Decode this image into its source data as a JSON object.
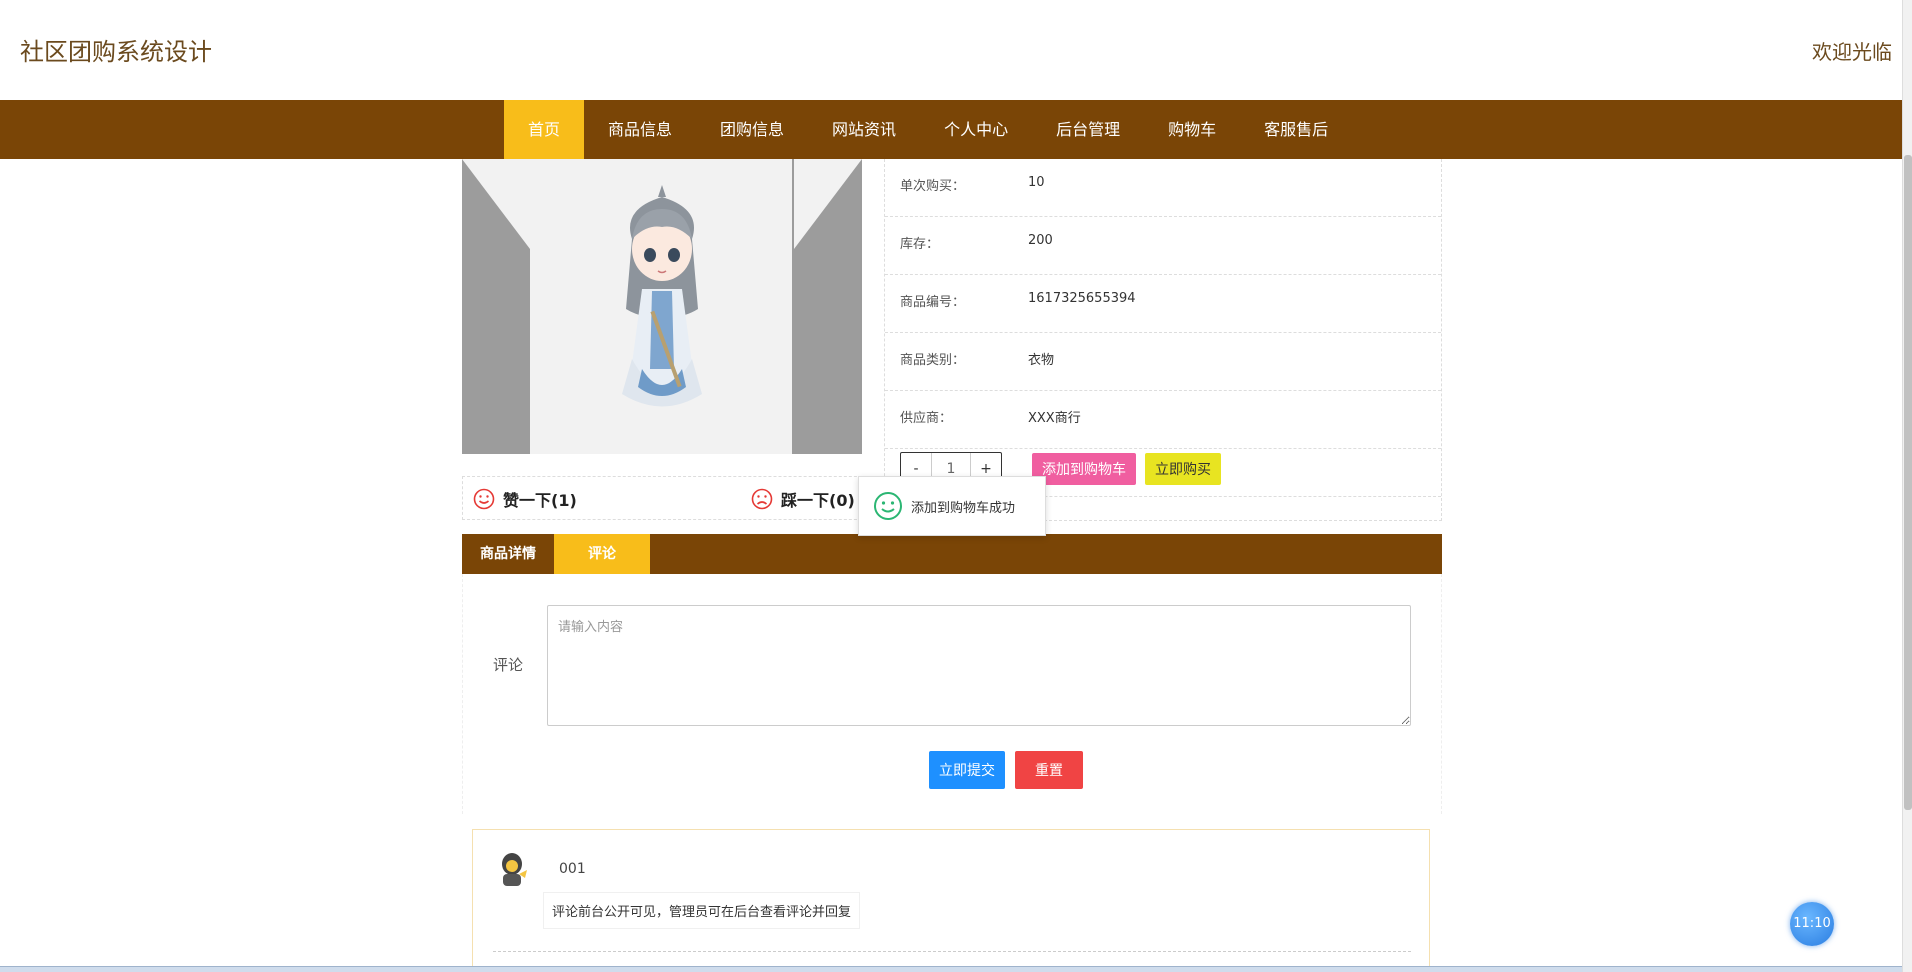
{
  "header": {
    "site_title": "社区团购系统设计",
    "welcome": "欢迎光临"
  },
  "nav": {
    "items": [
      {
        "label": "首页",
        "active": true
      },
      {
        "label": "商品信息",
        "active": false
      },
      {
        "label": "团购信息",
        "active": false
      },
      {
        "label": "网站资讯",
        "active": false
      },
      {
        "label": "个人中心",
        "active": false
      },
      {
        "label": "后台管理",
        "active": false
      },
      {
        "label": "购物车",
        "active": false
      },
      {
        "label": "客服售后",
        "active": false
      }
    ],
    "colors": {
      "bar": "#7a4506",
      "active": "#f8bd1a"
    }
  },
  "product": {
    "info": [
      {
        "label": "单次购买：",
        "value": "10"
      },
      {
        "label": "库存：",
        "value": "200"
      },
      {
        "label": "商品编号：",
        "value": "1617325655394"
      },
      {
        "label": "商品类别：",
        "value": "衣物"
      },
      {
        "label": "供应商：",
        "value": "XXX商行"
      }
    ],
    "quantity": {
      "minus": "-",
      "value": "1",
      "plus": "+"
    },
    "add_to_cart": "添加到购物车",
    "buy_now": "立即购买"
  },
  "votes": {
    "like": "赞一下(1)",
    "dislike": "踩一下(0)"
  },
  "toast": {
    "message": "添加到购物车成功"
  },
  "tabs": [
    {
      "label": "商品详情",
      "active": false
    },
    {
      "label": "评论",
      "active": true
    }
  ],
  "comment_form": {
    "label": "评论",
    "placeholder": "请输入内容",
    "submit": "立即提交",
    "reset": "重置"
  },
  "comments": [
    {
      "user": "001",
      "text": "评论前台公开可见，管理员可在后台查看评论并回复"
    }
  ],
  "clock": "11:10"
}
